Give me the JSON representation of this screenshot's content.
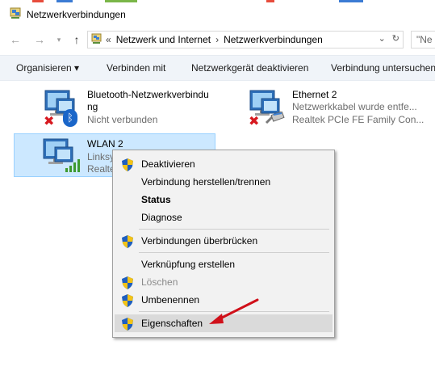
{
  "window": {
    "title": "Netzwerkverbindungen"
  },
  "address_bar": {
    "prefix": "«",
    "breadcrumbs": [
      "Netzwerk und Internet",
      "Netzwerkverbindungen"
    ],
    "separator": "›",
    "search_placeholder": "\"Ne"
  },
  "toolbar": {
    "organize": "Organisieren ▾",
    "connect": "Verbinden mit",
    "disable": "Netzwerkgerät deaktivieren",
    "diagnose": "Verbindung untersuchen"
  },
  "connections": [
    {
      "name_line1": "Bluetooth-Netzwerkverbindu",
      "name_line2": "ng",
      "status": "Nicht verbunden"
    },
    {
      "name": "Ethernet 2",
      "status": "Netzwerkkabel wurde entfe...",
      "device": "Realtek PCIe FE Family Con..."
    },
    {
      "name": "WLAN 2",
      "status": "Linksy",
      "device": "Realte"
    }
  ],
  "context_menu": {
    "items": [
      {
        "label": "Deaktivieren",
        "shield": true
      },
      {
        "label": "Verbindung herstellen/trennen",
        "shield": false
      },
      {
        "label": "Status",
        "shield": false,
        "bold": true
      },
      {
        "label": "Diagnose",
        "shield": false
      },
      {
        "label": "Verbindungen überbrücken",
        "shield": true
      },
      {
        "label": "Verknüpfung erstellen",
        "shield": false
      },
      {
        "label": "Löschen",
        "shield": true,
        "disabled": true
      },
      {
        "label": "Umbenennen",
        "shield": true
      },
      {
        "label": "Eigenschaften",
        "shield": true,
        "highlighted": true
      }
    ]
  },
  "colors": {
    "selection_bg": "#cce8ff",
    "toolbar_bg": "#f0f4f9",
    "menu_bg": "#f2f2f2",
    "arrow": "#d0101a"
  }
}
